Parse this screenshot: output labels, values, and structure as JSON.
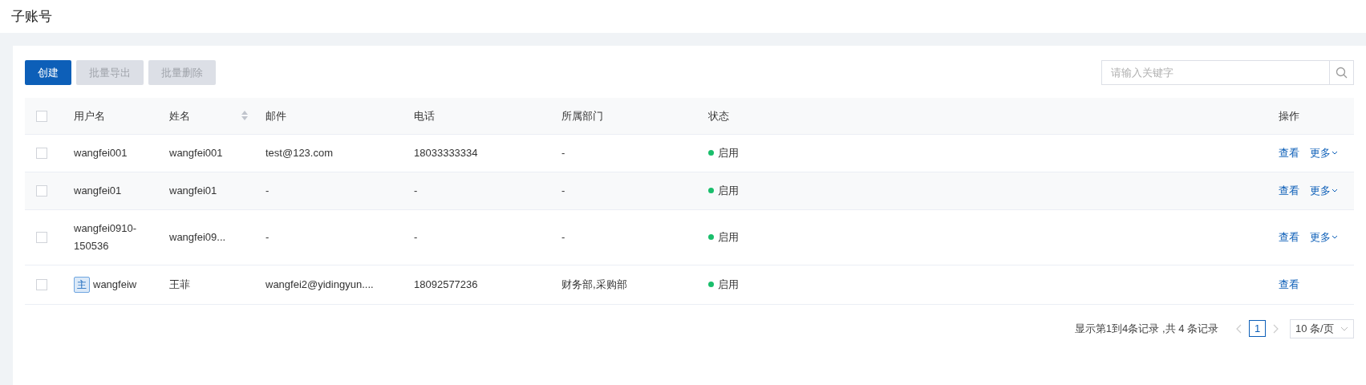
{
  "page_title": "子账号",
  "toolbar": {
    "buttons": [
      {
        "label": "创建",
        "disabled": false
      },
      {
        "label": "批量导出",
        "disabled": true
      },
      {
        "label": "批量删除",
        "disabled": true
      }
    ],
    "search": {
      "placeholder": "请输入关键字"
    }
  },
  "table": {
    "select_all": {
      "checked": false
    },
    "columns": [
      {
        "label": "用户名",
        "sortable": false
      },
      {
        "label": "姓名",
        "sortable": true
      },
      {
        "label": "邮件",
        "sortable": false
      },
      {
        "label": "电话",
        "sortable": false
      },
      {
        "label": "所属部门",
        "sortable": false
      },
      {
        "label": "状态",
        "sortable": false
      },
      {
        "label": "操作",
        "sortable": false
      }
    ],
    "rows": [
      {
        "checked": false,
        "highlighted": false,
        "badge": null,
        "username": "wangfei001",
        "name": "wangfei001",
        "email": "test@123.com",
        "phone": "18033333334",
        "department": "-",
        "status": {
          "label": "启用",
          "color": "#19be6b"
        },
        "actions": [
          {
            "label": "查看",
            "dropdown": false
          },
          {
            "label": "更多",
            "dropdown": true
          }
        ]
      },
      {
        "checked": false,
        "highlighted": true,
        "badge": null,
        "username": "wangfei01",
        "name": "wangfei01",
        "email": "-",
        "phone": "-",
        "department": "-",
        "status": {
          "label": "启用",
          "color": "#19be6b"
        },
        "actions": [
          {
            "label": "查看",
            "dropdown": false
          },
          {
            "label": "更多",
            "dropdown": true
          }
        ]
      },
      {
        "checked": false,
        "highlighted": false,
        "badge": null,
        "username": "wangfei0910-150536",
        "name": "wangfei09...",
        "email": "-",
        "phone": "-",
        "department": "-",
        "status": {
          "label": "启用",
          "color": "#19be6b"
        },
        "actions": [
          {
            "label": "查看",
            "dropdown": false
          },
          {
            "label": "更多",
            "dropdown": true
          }
        ]
      },
      {
        "checked": false,
        "highlighted": false,
        "badge": "主",
        "username": "wangfeiw",
        "name": "王菲",
        "email": "wangfei2@yidingyun....",
        "phone": "18092577236",
        "department": "财务部,采购部",
        "status": {
          "label": "启用",
          "color": "#19be6b"
        },
        "actions": [
          {
            "label": "查看",
            "dropdown": false
          }
        ]
      }
    ]
  },
  "pagination": {
    "summary": "显示第1到4条记录 ,共 4 条记录",
    "prev_disabled": true,
    "next_disabled": true,
    "pages": [
      {
        "label": "1",
        "selected": true
      }
    ],
    "page_size": "10 条/页"
  }
}
